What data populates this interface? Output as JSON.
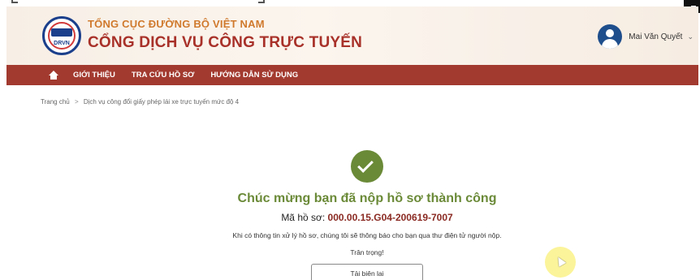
{
  "header": {
    "logo_text": "DRVN",
    "org_name": "TỔNG CỤC ĐƯỜNG BỘ VIỆT NAM",
    "portal_name": "CỔNG DỊCH VỤ CÔNG TRỰC TUYẾN",
    "user_name": "Mai Văn Quyết",
    "user_menu_icon": "chevron-down-icon"
  },
  "nav": {
    "home_icon": "home-icon",
    "items": [
      {
        "label": "GIỚI THIỆU"
      },
      {
        "label": "TRA CỨU HỒ SƠ"
      },
      {
        "label": "HƯỚNG DẪN SỬ DỤNG"
      }
    ]
  },
  "breadcrumb": {
    "home": "Trang chủ",
    "separator": ">",
    "current": "Dịch vụ công đổi giấy phép lái xe trực tuyến mức độ 4"
  },
  "result": {
    "icon": "check-circle-icon",
    "title": "Chúc mừng bạn đã nộp hồ sơ thành công",
    "dossier_label": "Mã hồ sơ:",
    "dossier_code": "000.00.15.G04-200619-7007",
    "notice": "Khi có thông tin xử lý hồ sơ, chúng tôi sẽ thông báo cho bạn qua thư điện tử người nộp.",
    "regards": "Trân trọng!",
    "download_label": "Tải biên lai"
  },
  "colors": {
    "nav_bg": "#a33a2f",
    "title_red": "#a8322a",
    "org_orange": "#d07a2e",
    "success_green": "#6b8a38",
    "code_red": "#8a2a22"
  }
}
